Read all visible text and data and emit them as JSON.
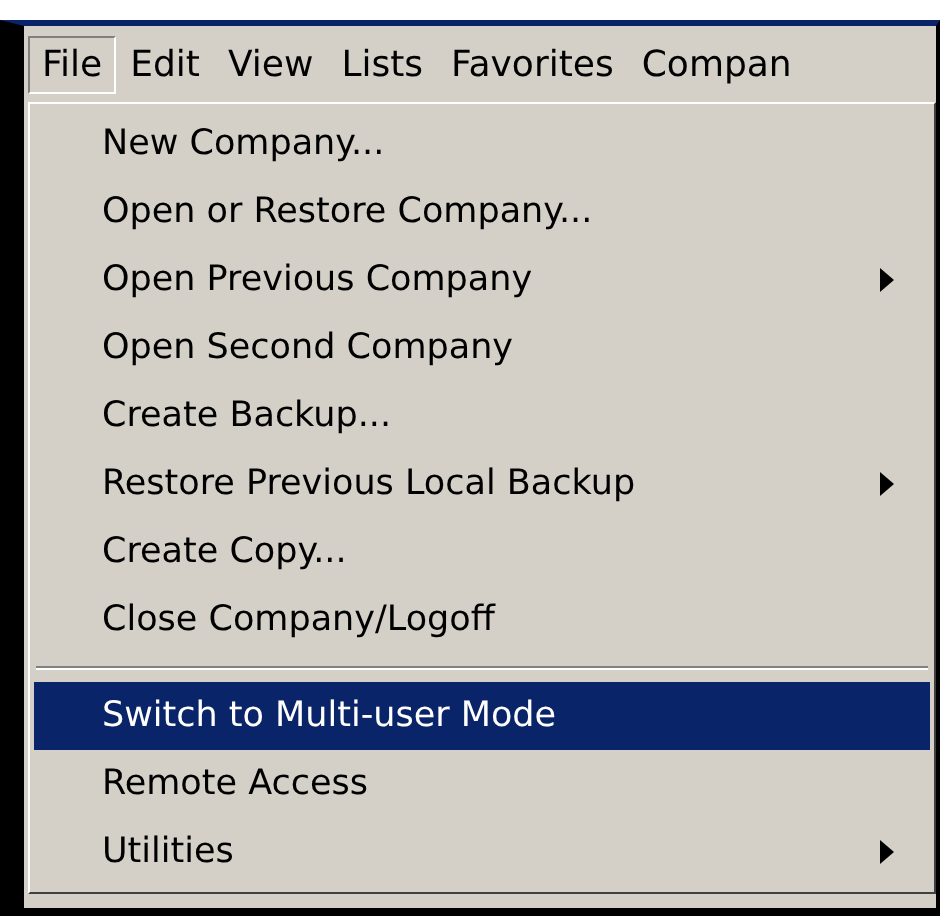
{
  "menubar": [
    {
      "label": "File",
      "selected": true
    },
    {
      "label": "Edit",
      "selected": false
    },
    {
      "label": "View",
      "selected": false
    },
    {
      "label": "Lists",
      "selected": false
    },
    {
      "label": "Favorites",
      "selected": false
    },
    {
      "label": "Compan",
      "selected": false
    }
  ],
  "menu": {
    "items": [
      {
        "kind": "item",
        "label": "New Company...",
        "submenu": false,
        "selected": false
      },
      {
        "kind": "item",
        "label": "Open or Restore Company...",
        "submenu": false,
        "selected": false
      },
      {
        "kind": "item",
        "label": "Open Previous Company",
        "submenu": true,
        "selected": false
      },
      {
        "kind": "item",
        "label": "Open Second Company",
        "submenu": false,
        "selected": false
      },
      {
        "kind": "item",
        "label": "Create Backup...",
        "submenu": false,
        "selected": false
      },
      {
        "kind": "item",
        "label": "Restore Previous Local Backup",
        "submenu": true,
        "selected": false
      },
      {
        "kind": "item",
        "label": "Create Copy...",
        "submenu": false,
        "selected": false
      },
      {
        "kind": "item",
        "label": "Close Company/Logoff",
        "submenu": false,
        "selected": false
      },
      {
        "kind": "separator"
      },
      {
        "kind": "item",
        "label": "Switch to Multi-user Mode",
        "submenu": false,
        "selected": true
      },
      {
        "kind": "item",
        "label": "Remote Access",
        "submenu": false,
        "selected": false
      },
      {
        "kind": "item",
        "label": "Utilities",
        "submenu": true,
        "selected": false
      }
    ]
  }
}
